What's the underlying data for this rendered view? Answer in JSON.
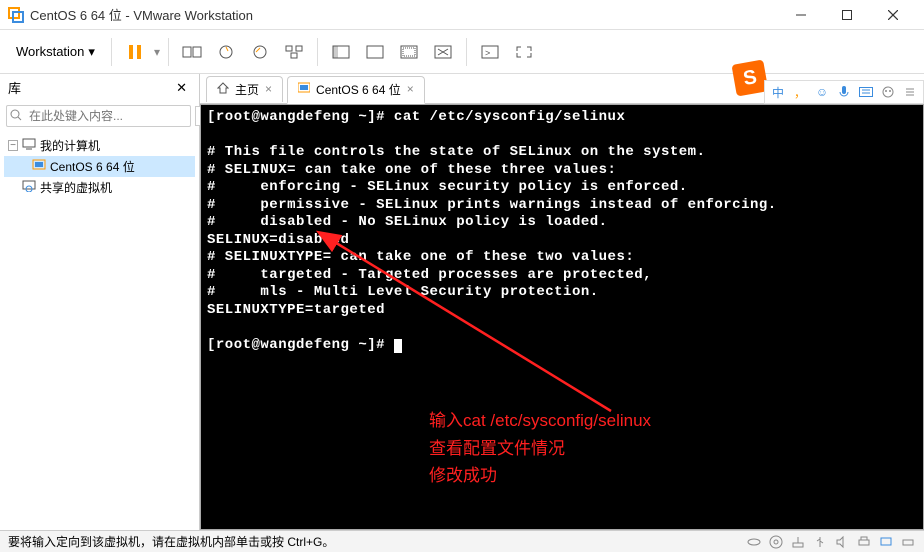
{
  "titlebar": {
    "title": "CentOS 6 64 位 - VMware Workstation"
  },
  "menubar": {
    "workstation": "Workstation"
  },
  "sidebar": {
    "header": "库",
    "search_placeholder": "在此处键入内容...",
    "nodes": {
      "root": "我的计算机",
      "vm": "CentOS 6 64 位",
      "shared": "共享的虚拟机"
    }
  },
  "tabs": {
    "home": "主页",
    "vm": "CentOS 6 64 位"
  },
  "terminal": {
    "lines": [
      "[root@wangdefeng ~]# cat /etc/sysconfig/selinux",
      "",
      "# This file controls the state of SELinux on the system.",
      "# SELINUX= can take one of these three values:",
      "#     enforcing - SELinux security policy is enforced.",
      "#     permissive - SELinux prints warnings instead of enforcing.",
      "#     disabled - No SELinux policy is loaded.",
      "SELINUX=disabled",
      "# SELINUXTYPE= can take one of these two values:",
      "#     targeted - Targeted processes are protected,",
      "#     mls - Multi Level Security protection.",
      "SELINUXTYPE=targeted",
      "",
      "[root@wangdefeng ~]# "
    ]
  },
  "annotation": {
    "line1": "输入cat /etc/sysconfig/selinux",
    "line2": "查看配置文件情况",
    "line3": "修改成功"
  },
  "statusbar": {
    "message": "要将输入定向到该虚拟机，请在虚拟机内部单击或按 Ctrl+G。"
  },
  "ime": {
    "lang": "中",
    "punct": "，",
    "smile": "☺"
  },
  "colors": {
    "accent": "#f90",
    "annotation": "#ff2020",
    "ime_blue": "#3b8cde",
    "sogou": "#ff6a00"
  }
}
